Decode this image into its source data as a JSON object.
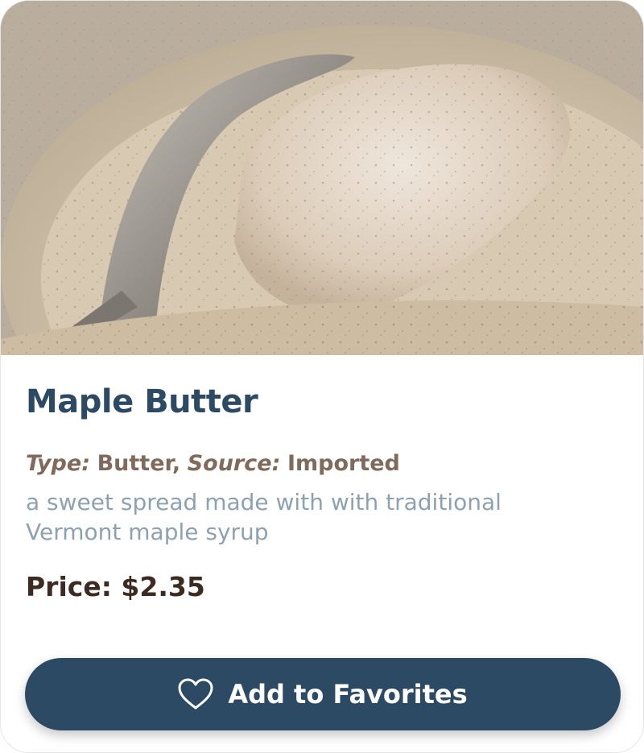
{
  "product": {
    "title": "Maple Butter",
    "image_alt": "a bowl of maple butter with a spoon",
    "type_label": "Type:",
    "type_value": "Butter,",
    "source_label": "Source:",
    "source_value": "Imported",
    "description": "a sweet spread made with with traditional Vermont maple syrup",
    "price_text": "Price: $2.35"
  },
  "actions": {
    "favorite_label": "Add to Favorites",
    "favorite_icon": "heart-outline-icon"
  },
  "colors": {
    "title": "#2c4a63",
    "meta": "#7f6a5c",
    "description": "#8ea1b0",
    "price": "#3b2b22",
    "button_bg": "#2c4a63",
    "button_text": "#ffffff"
  }
}
